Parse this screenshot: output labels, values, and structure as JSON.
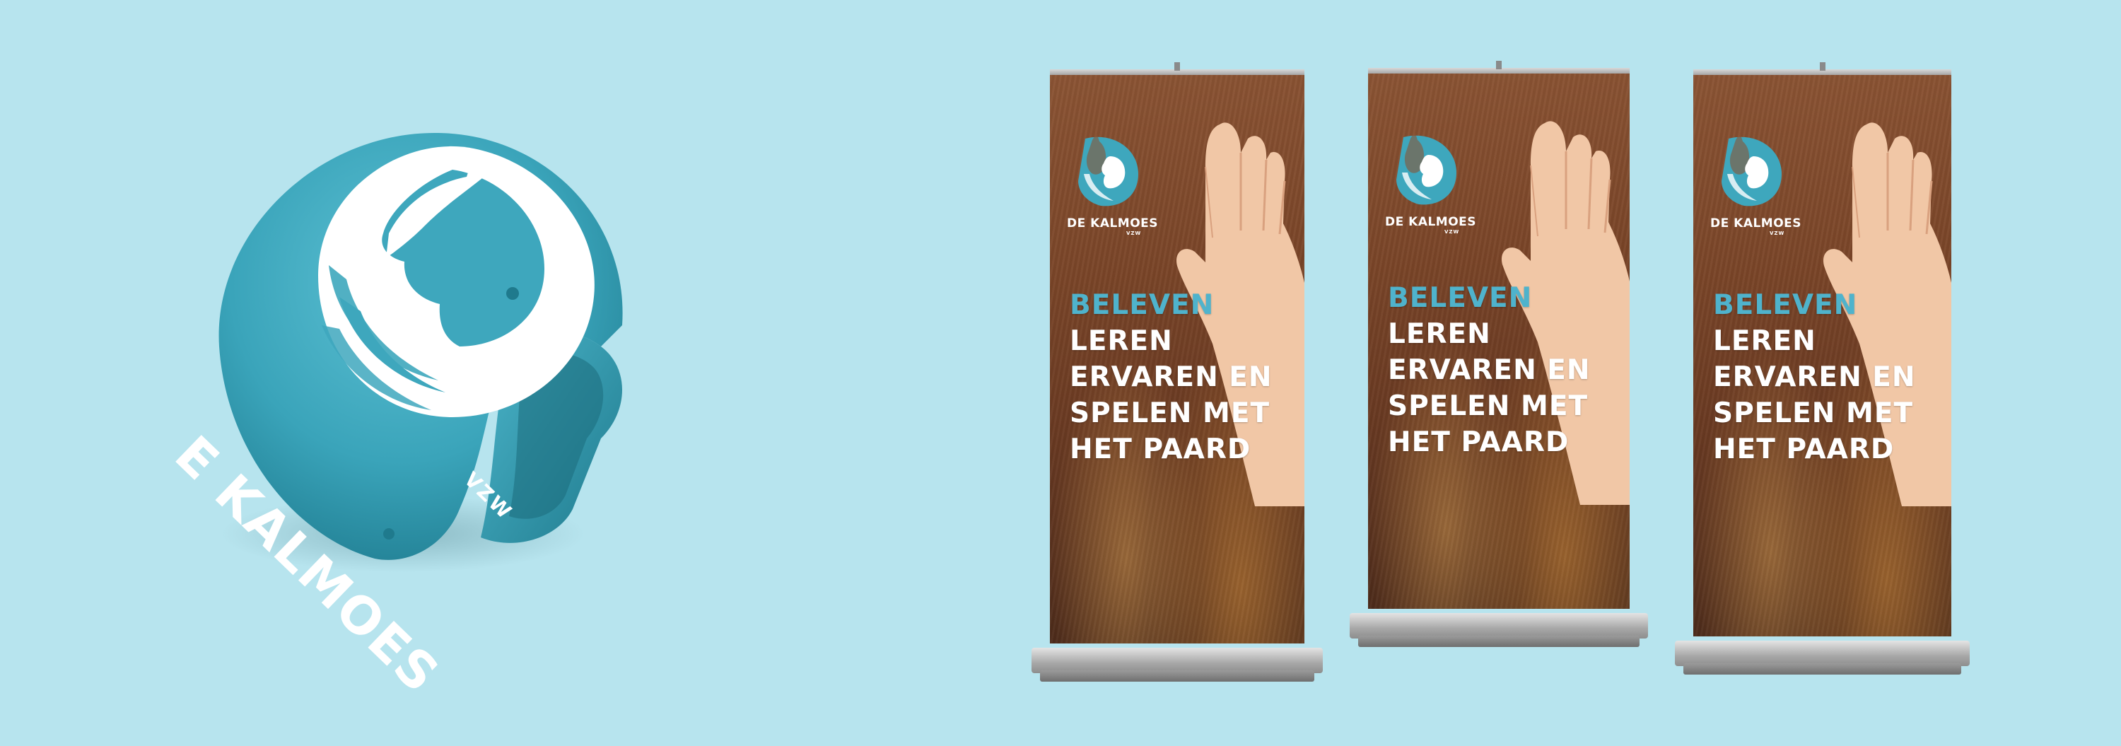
{
  "colors": {
    "background": "#b7e4ee",
    "brand_teal": "#3ea7bd",
    "accent_text": "#4fb3cc",
    "white": "#ffffff"
  },
  "helmet": {
    "text": "E KALMOES",
    "sub": "VZW",
    "icon": "horse-rider-logo-icon"
  },
  "banner": {
    "logo_name": "DE KALMOES",
    "logo_sub": "VZW",
    "logo_icon": "horse-rider-logo-icon",
    "headline_accent": "BELEVEN",
    "headline_lines": [
      "LEREN",
      "ERVAREN EN",
      "SPELEN MET",
      "HET PAARD"
    ]
  }
}
